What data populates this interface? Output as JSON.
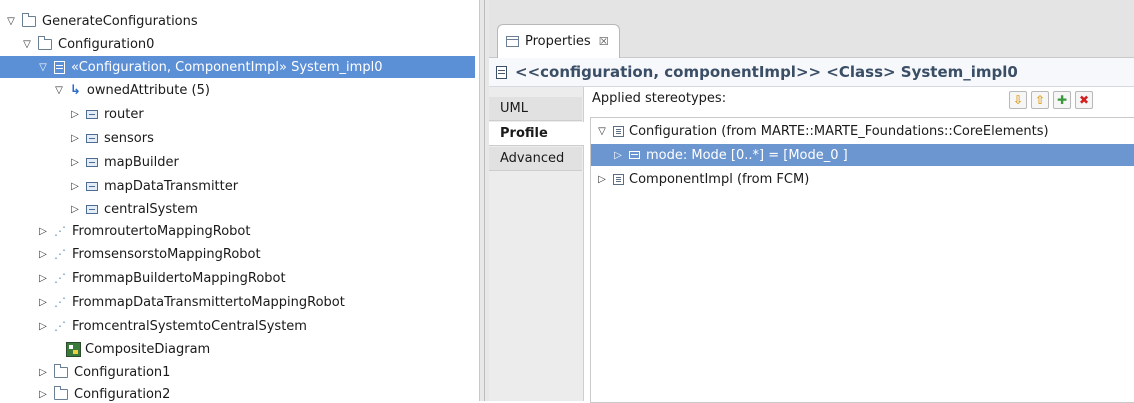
{
  "tree": {
    "items": [
      {
        "label": "GenerateConfigurations",
        "toggle": "▽",
        "icon": "folder-icon"
      },
      {
        "label": "Configuration0",
        "toggle": "▽",
        "icon": "folder-icon"
      },
      {
        "label": "«Configuration, ComponentImpl» System_impl0",
        "toggle": "▽",
        "icon": "class-icon",
        "selected": true
      },
      {
        "label": "ownedAttribute (5)",
        "toggle": "▽",
        "icon": "owned-attribute-icon"
      },
      {
        "label": "router",
        "toggle": "▷",
        "icon": "property-icon"
      },
      {
        "label": "sensors",
        "toggle": "▷",
        "icon": "property-icon"
      },
      {
        "label": "mapBuilder",
        "toggle": "▷",
        "icon": "property-icon"
      },
      {
        "label": "mapDataTransmitter",
        "toggle": "▷",
        "icon": "property-icon"
      },
      {
        "label": "centralSystem",
        "toggle": "▷",
        "icon": "property-icon"
      },
      {
        "label": "FromroutertoMappingRobot",
        "toggle": "▷",
        "icon": "connector-icon"
      },
      {
        "label": "FromsensorstoMappingRobot",
        "toggle": "▷",
        "icon": "connector-icon"
      },
      {
        "label": "FrommapBuildertoMappingRobot",
        "toggle": "▷",
        "icon": "connector-icon"
      },
      {
        "label": "FrommapDataTransmittertoMappingRobot",
        "toggle": "▷",
        "icon": "connector-icon"
      },
      {
        "label": "FromcentralSystemtoCentralSystem",
        "toggle": "▷",
        "icon": "connector-icon"
      },
      {
        "label": "CompositeDiagram",
        "toggle": "",
        "icon": "composite-diagram-icon"
      },
      {
        "label": "Configuration1",
        "toggle": "▷",
        "icon": "folder-icon"
      },
      {
        "label": "Configuration2",
        "toggle": "▷",
        "icon": "folder-icon"
      }
    ]
  },
  "properties": {
    "tab_label": "Properties",
    "tab_close": "☒",
    "title": "<<configuration, componentImpl>> <Class> System_impl0",
    "side_tabs": [
      "UML",
      "Profile",
      "Advanced"
    ],
    "active_side_tab": "Profile",
    "applied_label": "Applied stereotypes:",
    "buttons": [
      {
        "icon": "move-down-icon",
        "glyph": "⇩",
        "color": "#e0a020"
      },
      {
        "icon": "move-up-icon",
        "glyph": "⇧",
        "color": "#e0a020"
      },
      {
        "icon": "add-icon",
        "glyph": "✚",
        "color": "#3a9a3a"
      },
      {
        "icon": "delete-icon",
        "glyph": "✖",
        "color": "#d02020"
      }
    ],
    "stereotypes": [
      {
        "toggle": "▽",
        "label": "Configuration   (from MARTE::MARTE_Foundations::CoreElements)",
        "icon": "stereotype-icon"
      },
      {
        "toggle": "▷",
        "label": "mode: Mode [0..*] = [Mode_0  ]",
        "icon": "property-icon",
        "selected": true
      },
      {
        "toggle": "▷",
        "label": "ComponentImpl   (from FCM)",
        "icon": "stereotype-icon"
      }
    ]
  }
}
